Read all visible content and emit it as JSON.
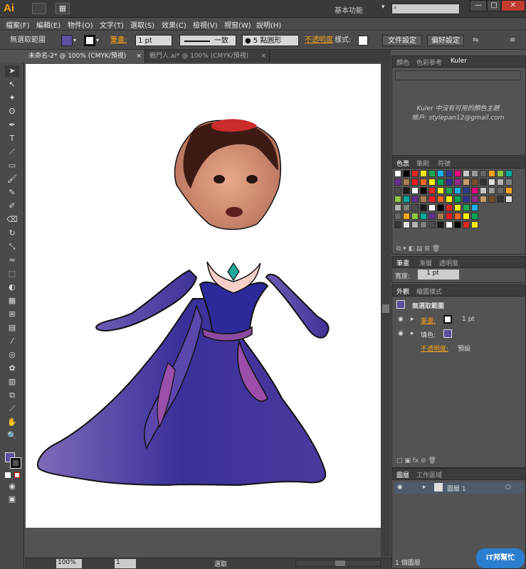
{
  "app": {
    "logo": "Ai",
    "workspace": "基本功能",
    "window_buttons": [
      "—",
      "□",
      "✕"
    ]
  },
  "menu": [
    "檔案(F)",
    "編輯(E)",
    "物件(O)",
    "文字(T)",
    "選取(S)",
    "效果(C)",
    "檢視(V)",
    "視窗(W)",
    "說明(H)"
  ],
  "control": {
    "selection": "無選取範圍",
    "stroke_label": "筆畫:",
    "stroke_value": "1 pt",
    "line_style": "一致",
    "brush": "5 點圓形",
    "opacity_label": "不透明度",
    "style_label": "樣式:",
    "doc_setup": "文件設定",
    "prefs": "偏好設定"
  },
  "tabs": [
    "未命名-2* @ 100% (CMYK/預視)",
    "戰鬥人.ai* @ 100% (CMYK/預視)"
  ],
  "kuler_panel": {
    "tabs": [
      "顏色",
      "色彩參考",
      "Kuler"
    ],
    "message": "Kuler 中沒有可用的顏色主題",
    "account": "帳戶: stylepan12@gmail.com"
  },
  "swatches_panel": {
    "tabs": [
      "色票",
      "筆刷",
      "符號"
    ]
  },
  "stroke_panel": {
    "tabs": [
      "筆畫",
      "漸層",
      "透明度"
    ],
    "weight_label": "寬度:",
    "weight_value": "1 pt"
  },
  "appearance_panel": {
    "tabs": [
      "外觀",
      "繪圖樣式"
    ],
    "title": "無選取範圍",
    "stroke_label": "筆畫:",
    "stroke_value": "1 pt",
    "fill_label": "填色:",
    "opacity_label": "不透明度:",
    "opacity_value": "預設"
  },
  "layers_panel": {
    "tabs": [
      "圖層",
      "工作區域"
    ],
    "layer_name": "圖層 1",
    "footer": "1 個圖層"
  },
  "status": {
    "zoom": "100%",
    "page": "1",
    "mode": "選取"
  },
  "watermark": "iT邦幫忙",
  "colors": {
    "accent_orange": "#f7a21b",
    "dress_blue": "#3b2f8f",
    "dress_purple": "#6a4fb0",
    "dress_pink": "#9b4fa8"
  }
}
